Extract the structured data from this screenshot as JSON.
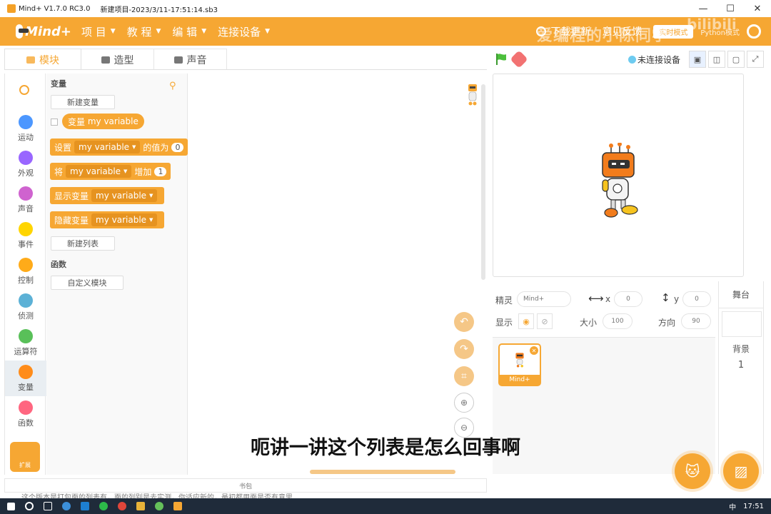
{
  "window": {
    "app_title": "Mind+ V1.7.0 RC3.0",
    "project_title": "新建项目-2023/3/11-17:51:14.sb3",
    "controls": [
      "—",
      "☐",
      "✕"
    ]
  },
  "menubar": {
    "logo": "Mind+",
    "items": [
      {
        "label": "项 目"
      },
      {
        "label": "教 程"
      },
      {
        "label": "编 辑"
      },
      {
        "label": "连接设备"
      }
    ],
    "download": "下载更新",
    "feedback": "意见反馈",
    "mode_button": "实时模式",
    "python_mode": "Python模式",
    "watermark": "爱编程的小陈同学",
    "bili": "bilibili"
  },
  "tabs": [
    {
      "label": "模块"
    },
    {
      "label": "造型"
    },
    {
      "label": "声音"
    }
  ],
  "connection": {
    "status": "未连接设备"
  },
  "categories": [
    {
      "label": "运动",
      "color": "#4c97ff"
    },
    {
      "label": "外观",
      "color": "#9966ff"
    },
    {
      "label": "声音",
      "color": "#cf63cf"
    },
    {
      "label": "事件",
      "color": "#ffd500"
    },
    {
      "label": "控制",
      "color": "#ffab19"
    },
    {
      "label": "侦测",
      "color": "#5cb1d6"
    },
    {
      "label": "运算符",
      "color": "#59c059"
    },
    {
      "label": "变量",
      "color": "#ff8c1a"
    },
    {
      "label": "函数",
      "color": "#ff6680"
    }
  ],
  "extension_label": "扩展",
  "palette": {
    "section_variables": "变量",
    "new_variable": "新建变量",
    "reporter_prefix": "变量",
    "var_name": "my variable",
    "set_block": {
      "prefix": "设置",
      "middle": "的值为",
      "value": "0"
    },
    "change_block": {
      "prefix": "将",
      "middle": "增加",
      "value": "1"
    },
    "show_block": "显示变量",
    "hide_block": "隐藏变量",
    "new_list": "新建列表",
    "section_functions": "函数",
    "custom_block": "自定义模块"
  },
  "backpack_label": "书包",
  "sprite_info": {
    "sprite_label": "精灵",
    "sprite_name": "Mind+",
    "x_label": "x",
    "x_value": "0",
    "y_label": "y",
    "y_value": "0",
    "show_label": "显示",
    "size_label": "大小",
    "size_value": "100",
    "direction_label": "方向",
    "direction_value": "90"
  },
  "sprite_card": {
    "name": "Mind+"
  },
  "stage_panel": {
    "title": "舞台",
    "backdrop_label": "背景",
    "backdrop_count": "1"
  },
  "subtitle": "呃讲一讲这个列表是怎么回事啊",
  "subtitle_faint": "这个版本是打包面的列表有，面的列别是去实测，你适应新的，最初都用面是否有意思",
  "taskbar": {
    "time": "17:51",
    "ime": "中"
  }
}
